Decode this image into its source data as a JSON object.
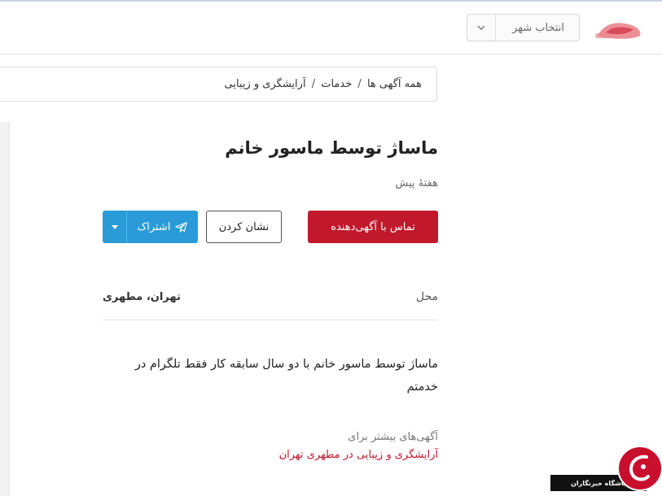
{
  "header": {
    "city_select_label": "انتخاب شهر"
  },
  "breadcrumb": {
    "items": [
      "همه آگهی ها",
      "خدمات",
      "آرایشگری و زیبایی"
    ],
    "separator": "/"
  },
  "ad": {
    "title": "ماساژ توسط ماسور خانم",
    "time": "هفتهٔ پیش",
    "description_lines": [
      "ماساژ توسط ماسور خانم با دو سال سابقه کار فقط تلگرام در",
      "خدمتم"
    ]
  },
  "actions": {
    "contact_label": "تماس با آگهی‌دهنده",
    "mark_label": "نشان کردن",
    "share_label": "اشتراک"
  },
  "info": {
    "location_key": "محل",
    "location_value": "تهران، مطهری"
  },
  "more": {
    "label": "آگهی‌های بیشتر برای",
    "link": "آرایشگری و زیبایی در مطهری تهران"
  },
  "watermark": {
    "text": "باشگاه خبرنگاران"
  },
  "colors": {
    "brand_red": "#c2182b",
    "share_blue": "#2a9bd8"
  },
  "icons": {
    "city_select": "chevron-down-icon",
    "share": "telegram-icon",
    "share_caret": "caret-down-icon"
  }
}
